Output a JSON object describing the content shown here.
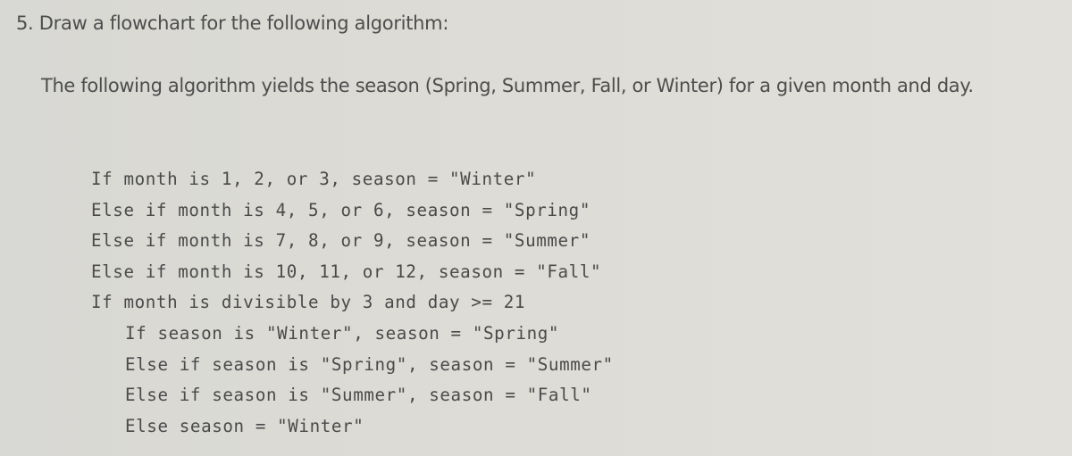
{
  "question": {
    "heading": "5. Draw a flowchart for the following algorithm:",
    "intro": "The following algorithm yields the season (Spring, Summer, Fall, or Winter) for a given month and day."
  },
  "algorithm": {
    "lines": [
      {
        "text": "If month is 1, 2, or 3, season = \"Winter\"",
        "indent": 0
      },
      {
        "text": "Else if month is 4, 5, or 6, season = \"Spring\"",
        "indent": 0
      },
      {
        "text": "Else if month is 7, 8, or 9, season = \"Summer\"",
        "indent": 0
      },
      {
        "text": "Else if month is 10, 11, or 12, season = \"Fall\"",
        "indent": 0
      },
      {
        "text": "If month is divisible by 3 and day >= 21",
        "indent": 0
      },
      {
        "text": "If season is \"Winter\", season = \"Spring\"",
        "indent": 1
      },
      {
        "text": "Else if season is \"Spring\", season = \"Summer\"",
        "indent": 1
      },
      {
        "text": "Else if season is \"Summer\", season = \"Fall\"",
        "indent": 1
      },
      {
        "text": "Else season = \"Winter\"",
        "indent": 1
      }
    ]
  }
}
